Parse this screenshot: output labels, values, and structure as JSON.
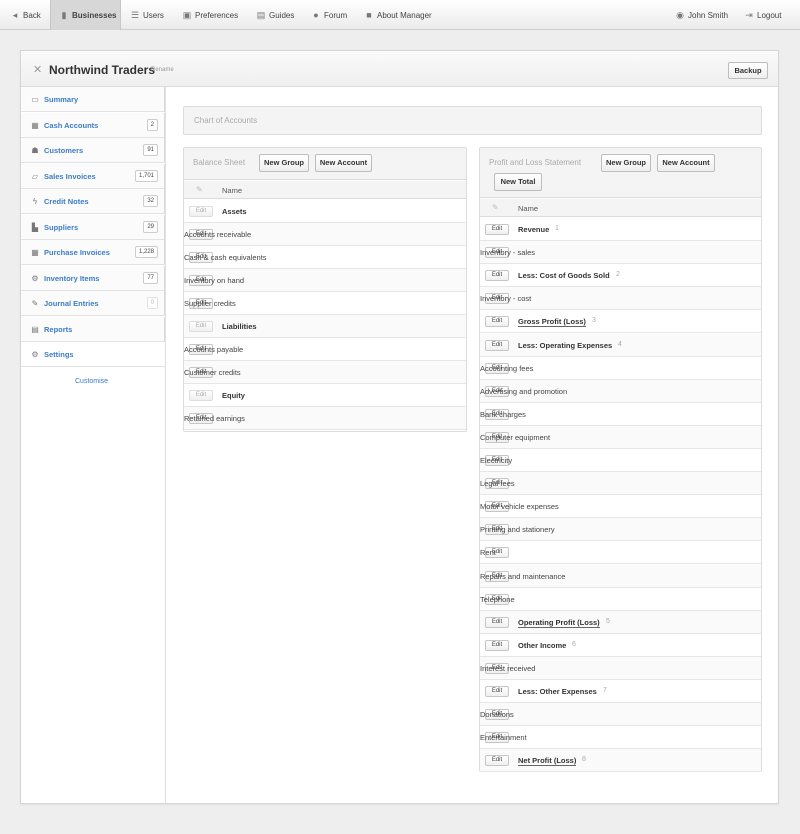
{
  "topnav": {
    "back": "Back",
    "businesses": "Businesses",
    "users": "Users",
    "preferences": "Preferences",
    "guides": "Guides",
    "forum": "Forum",
    "about": "About Manager",
    "user": "John Smith",
    "logout": "Logout"
  },
  "header": {
    "business_name": "Northwind Traders",
    "rename": "Rename",
    "backup": "Backup"
  },
  "sidebar": {
    "items": [
      {
        "label": "Summary",
        "icon": "monitor-icon",
        "count": ""
      },
      {
        "label": "Cash Accounts",
        "icon": "cash-icon",
        "count": "2"
      },
      {
        "label": "Customers",
        "icon": "people-icon",
        "count": "91"
      },
      {
        "label": "Sales Invoices",
        "icon": "inbox-icon",
        "count": "1,701"
      },
      {
        "label": "Credit Notes",
        "icon": "lightning-icon",
        "count": "32"
      },
      {
        "label": "Suppliers",
        "icon": "factory-icon",
        "count": "29"
      },
      {
        "label": "Purchase Invoices",
        "icon": "calendar-icon",
        "count": "1,228"
      },
      {
        "label": "Inventory Items",
        "icon": "gears-icon",
        "count": "77"
      },
      {
        "label": "Journal Entries",
        "icon": "quill-icon",
        "count": "0"
      },
      {
        "label": "Reports",
        "icon": "printer-icon",
        "count": ""
      },
      {
        "label": "Settings",
        "icon": "settings-icon",
        "count": ""
      }
    ],
    "customise": "Customise"
  },
  "main": {
    "title": "Chart of Accounts",
    "edit_label": "Edit",
    "name_header": "Name",
    "balance_sheet": {
      "title": "Balance Sheet",
      "new_group": "New Group",
      "new_account": "New Account",
      "rows": [
        {
          "type": "group",
          "name": "Assets"
        },
        {
          "type": "account",
          "name": "Accounts receivable"
        },
        {
          "type": "account",
          "name": "Cash & cash equivalents"
        },
        {
          "type": "account",
          "name": "Inventory on hand"
        },
        {
          "type": "account",
          "name": "Supplier credits"
        },
        {
          "type": "group",
          "name": "Liabilities"
        },
        {
          "type": "account",
          "name": "Accounts payable"
        },
        {
          "type": "account",
          "name": "Customer credits"
        },
        {
          "type": "group",
          "name": "Equity"
        },
        {
          "type": "account",
          "name": "Retained earnings"
        }
      ]
    },
    "profit_loss": {
      "title": "Profit and Loss Statement",
      "new_group": "New Group",
      "new_account": "New Account",
      "new_total": "New Total",
      "rows": [
        {
          "type": "group",
          "name": "Revenue",
          "num": "1"
        },
        {
          "type": "account",
          "name": "Inventory - sales"
        },
        {
          "type": "group",
          "name": "Less: Cost of Goods Sold",
          "num": "2"
        },
        {
          "type": "account",
          "name": "Inventory - cost"
        },
        {
          "type": "total",
          "name": "Gross Profit (Loss)",
          "num": "3"
        },
        {
          "type": "group",
          "name": "Less: Operating Expenses",
          "num": "4"
        },
        {
          "type": "account",
          "name": "Accounting fees"
        },
        {
          "type": "account",
          "name": "Advertising and promotion"
        },
        {
          "type": "account",
          "name": "Bank charges"
        },
        {
          "type": "account",
          "name": "Computer equipment"
        },
        {
          "type": "account",
          "name": "Electricity"
        },
        {
          "type": "account",
          "name": "Legal fees"
        },
        {
          "type": "account",
          "name": "Motor vehicle expenses"
        },
        {
          "type": "account",
          "name": "Printing and stationery"
        },
        {
          "type": "account",
          "name": "Rent"
        },
        {
          "type": "account",
          "name": "Repairs and maintenance"
        },
        {
          "type": "account",
          "name": "Telephone"
        },
        {
          "type": "total",
          "name": "Operating Profit (Loss)",
          "num": "5"
        },
        {
          "type": "group",
          "name": "Other Income",
          "num": "6"
        },
        {
          "type": "account",
          "name": "Interest received"
        },
        {
          "type": "group",
          "name": "Less: Other Expenses",
          "num": "7"
        },
        {
          "type": "account",
          "name": "Donations"
        },
        {
          "type": "account",
          "name": "Entertainment"
        },
        {
          "type": "total",
          "name": "Net Profit (Loss)",
          "num": "8"
        }
      ]
    }
  },
  "colors": {
    "link": "#3b7cc4",
    "active_nav": "#d7d7d7",
    "panel_bg": "#ffffff",
    "page_bg": "#eeeeee"
  }
}
